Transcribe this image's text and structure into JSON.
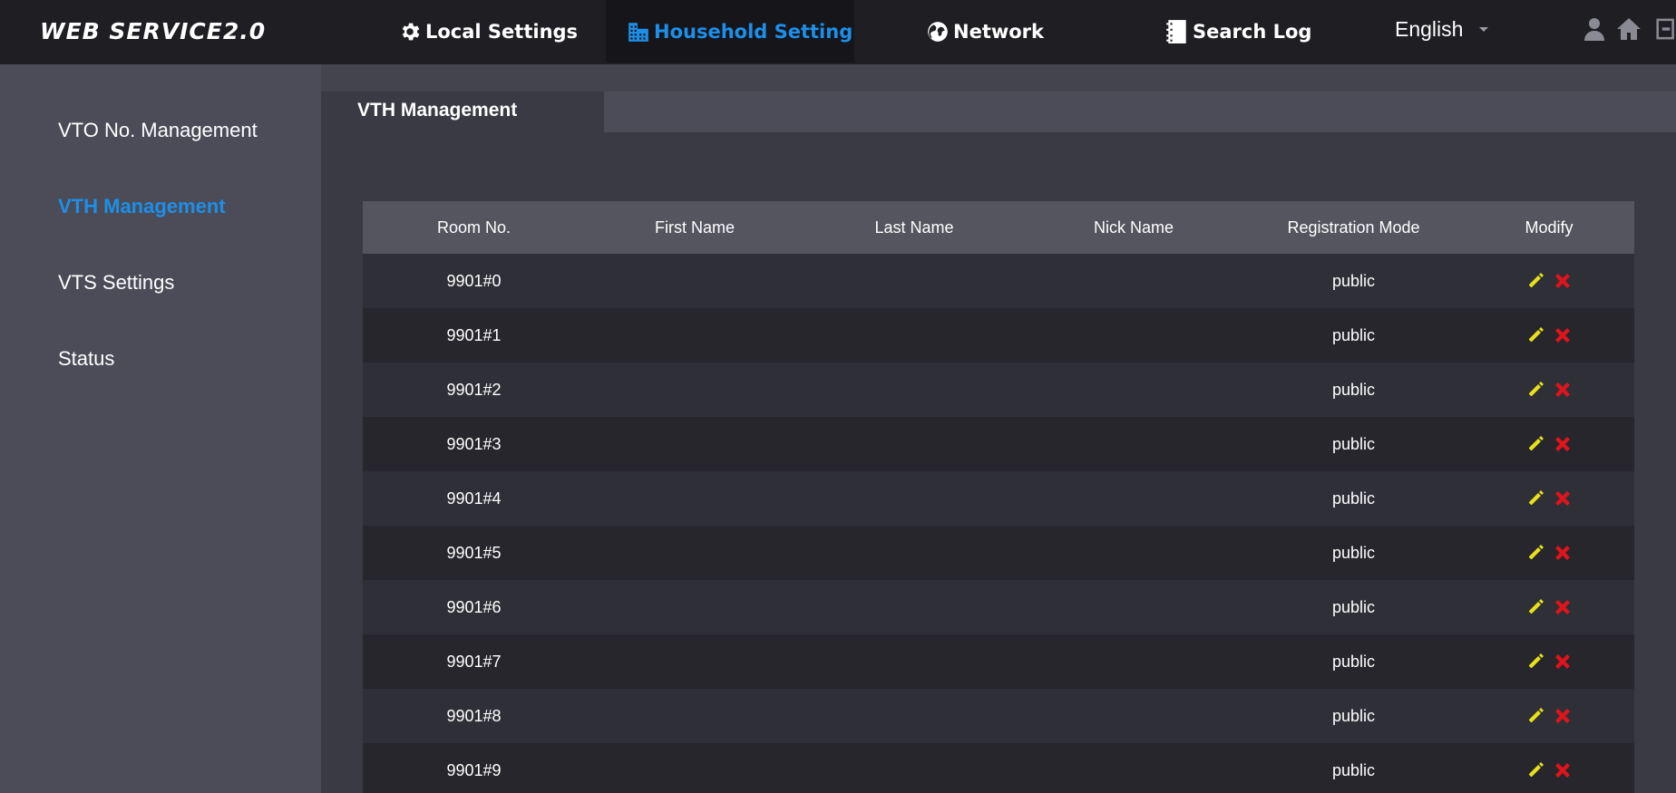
{
  "app": {
    "logo": "WEB SERVICE2.0"
  },
  "nav": {
    "local_settings": "Local Settings",
    "household_setting": "Household Setting",
    "network": "Network",
    "search_log": "Search Log",
    "language": "English"
  },
  "sidebar": {
    "items": [
      {
        "label": "VTO No. Management"
      },
      {
        "label": "VTH Management",
        "active": true
      },
      {
        "label": "VTS Settings"
      },
      {
        "label": "Status"
      }
    ]
  },
  "tab": {
    "label": "VTH Management"
  },
  "table": {
    "columns": [
      "Room No.",
      "First Name",
      "Last Name",
      "Nick Name",
      "Registration Mode",
      "Modify"
    ],
    "rows": [
      {
        "room": "9901#0",
        "first": "",
        "last": "",
        "nick": "",
        "mode": "public"
      },
      {
        "room": "9901#1",
        "first": "",
        "last": "",
        "nick": "",
        "mode": "public"
      },
      {
        "room": "9901#2",
        "first": "",
        "last": "",
        "nick": "",
        "mode": "public"
      },
      {
        "room": "9901#3",
        "first": "",
        "last": "",
        "nick": "",
        "mode": "public"
      },
      {
        "room": "9901#4",
        "first": "",
        "last": "",
        "nick": "",
        "mode": "public"
      },
      {
        "room": "9901#5",
        "first": "",
        "last": "",
        "nick": "",
        "mode": "public"
      },
      {
        "room": "9901#6",
        "first": "",
        "last": "",
        "nick": "",
        "mode": "public"
      },
      {
        "room": "9901#7",
        "first": "",
        "last": "",
        "nick": "",
        "mode": "public"
      },
      {
        "room": "9901#8",
        "first": "",
        "last": "",
        "nick": "",
        "mode": "public"
      },
      {
        "room": "9901#9",
        "first": "",
        "last": "",
        "nick": "",
        "mode": "public"
      }
    ]
  },
  "icons": {
    "local_settings": "gear-icon",
    "household_setting": "building-icon",
    "network": "globe-icon",
    "search_log": "log-icon",
    "user": "user-icon",
    "home": "home-icon",
    "logout": "logout-icon",
    "edit": "pencil-icon",
    "delete": "delete-x-icon"
  },
  "colors": {
    "accent": "#1d8fe8",
    "edit": "#e8e01a",
    "delete": "#e0141a",
    "topbar": "#1e1e23",
    "sidebar": "#4c4c58",
    "content": "#3a3a44"
  }
}
